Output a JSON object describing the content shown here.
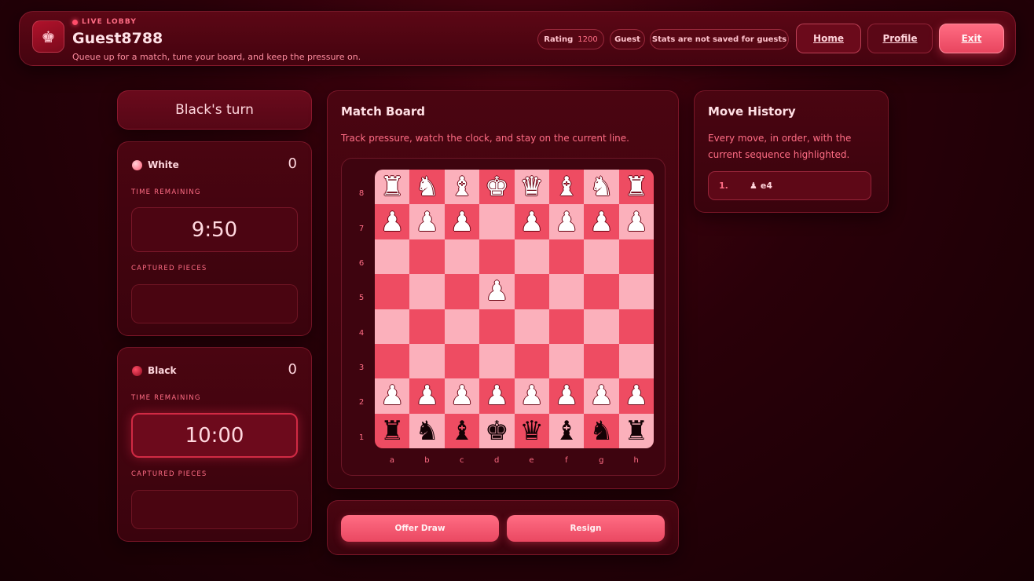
{
  "header": {
    "live_label": "LIVE LOBBY",
    "username": "Guest8788",
    "subtitle": "Queue up for a match, tune your board, and keep the pressure on.",
    "rating_label": "Rating",
    "rating_value": "1200",
    "guest_badge": "Guest",
    "stats_note": "Stats are not saved for guests",
    "nav": {
      "home": "Home",
      "profile": "Profile",
      "exit": "Exit"
    },
    "logo_icon": "crown-icon"
  },
  "turn_text": "Black's turn",
  "players": {
    "white": {
      "name": "White",
      "score": "0",
      "time_label": "TIME REMAINING",
      "time": "9:50",
      "captured_label": "CAPTURED PIECES"
    },
    "black": {
      "name": "Black",
      "score": "0",
      "time_label": "TIME REMAINING",
      "time": "10:00",
      "captured_label": "CAPTURED PIECES"
    }
  },
  "board_panel": {
    "title": "Match Board",
    "description": "Track pressure, watch the clock, and stay on the current line.",
    "ranks": [
      "8",
      "7",
      "6",
      "5",
      "4",
      "3",
      "2",
      "1"
    ],
    "files": [
      "a",
      "b",
      "c",
      "d",
      "e",
      "f",
      "g",
      "h"
    ],
    "rows": [
      [
        "wR",
        "wN",
        "wB",
        "wK",
        "wQ",
        "wB",
        "wN",
        "wR"
      ],
      [
        "wP",
        "wP",
        "wP",
        "",
        "wP",
        "wP",
        "wP",
        "wP"
      ],
      [
        "",
        "",
        "",
        "",
        "",
        "",
        "",
        ""
      ],
      [
        "",
        "",
        "",
        "wP",
        "",
        "",
        "",
        ""
      ],
      [
        "",
        "",
        "",
        "",
        "",
        "",
        "",
        ""
      ],
      [
        "",
        "",
        "",
        "",
        "",
        "",
        "",
        ""
      ],
      [
        "wP",
        "wP",
        "wP",
        "wP",
        "wP",
        "wP",
        "wP",
        "wP"
      ],
      [
        "bR",
        "bN",
        "bB",
        "bK",
        "bQ",
        "bB",
        "bN",
        "bR"
      ]
    ]
  },
  "actions": {
    "offer_draw": "Offer Draw",
    "resign": "Resign"
  },
  "history": {
    "title": "Move History",
    "description": "Every move, in order, with the current sequence highlighted.",
    "moves": [
      {
        "number": "1.",
        "san": "e4",
        "icon": "pawn-icon"
      }
    ]
  },
  "colors": {
    "accent": "#ff6d85",
    "board_light": "#fbb0bb",
    "board_dark": "#ee4c62",
    "background": "#2a0009"
  }
}
